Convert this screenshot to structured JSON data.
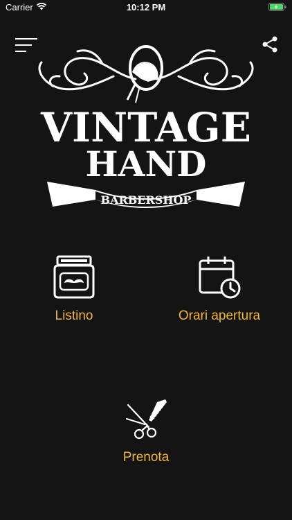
{
  "status_bar": {
    "carrier": "Carrier",
    "time": "10:12 PM"
  },
  "logo": {
    "line1": "VINTAGE",
    "line2": "HAND",
    "ribbon": "BARBERSHOP"
  },
  "menu": [
    {
      "id": "listino",
      "label": "Listino",
      "icon": "pomade-jar-icon"
    },
    {
      "id": "orari",
      "label": "Orari apertura",
      "icon": "calendar-clock-icon"
    },
    {
      "id": "prenota",
      "label": "Prenota",
      "icon": "scissors-comb-icon"
    }
  ],
  "colors": {
    "accent": "#f2b731",
    "background": "#141414",
    "foreground": "#ffffff"
  }
}
